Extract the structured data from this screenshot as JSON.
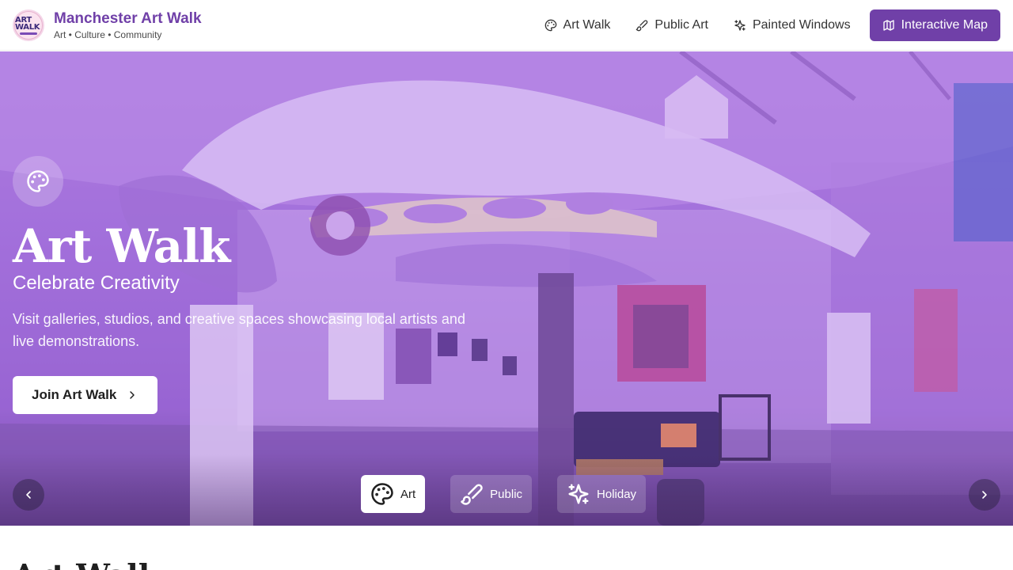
{
  "brand": {
    "logo_line1": "ART",
    "logo_line2": "WALK",
    "title": "Manchester Art Walk",
    "subtitle": "Art • Culture • Community"
  },
  "nav": {
    "items": [
      {
        "label": "Art Walk",
        "icon": "palette-icon"
      },
      {
        "label": "Public Art",
        "icon": "brush-icon"
      },
      {
        "label": "Painted Windows",
        "icon": "sparkles-icon"
      },
      {
        "label": "Interactive Map",
        "icon": "map-icon",
        "active": true
      }
    ]
  },
  "hero": {
    "icon": "palette-icon",
    "title": "Art Walk",
    "subtitle": "Celebrate Creativity",
    "description": "Visit galleries, studios, and creative spaces showcasing local artists and live demonstrations.",
    "cta_label": "Join Art Walk",
    "tabs": [
      {
        "label": "Art",
        "icon": "palette-icon",
        "active": true
      },
      {
        "label": "Public",
        "icon": "brush-icon"
      },
      {
        "label": "Holiday",
        "icon": "sparkles-icon"
      }
    ]
  },
  "section": {
    "heading": "Art Walk"
  },
  "colors": {
    "brand_purple": "#7040a8",
    "hero_tint": "#a877dd",
    "white": "#ffffff"
  }
}
